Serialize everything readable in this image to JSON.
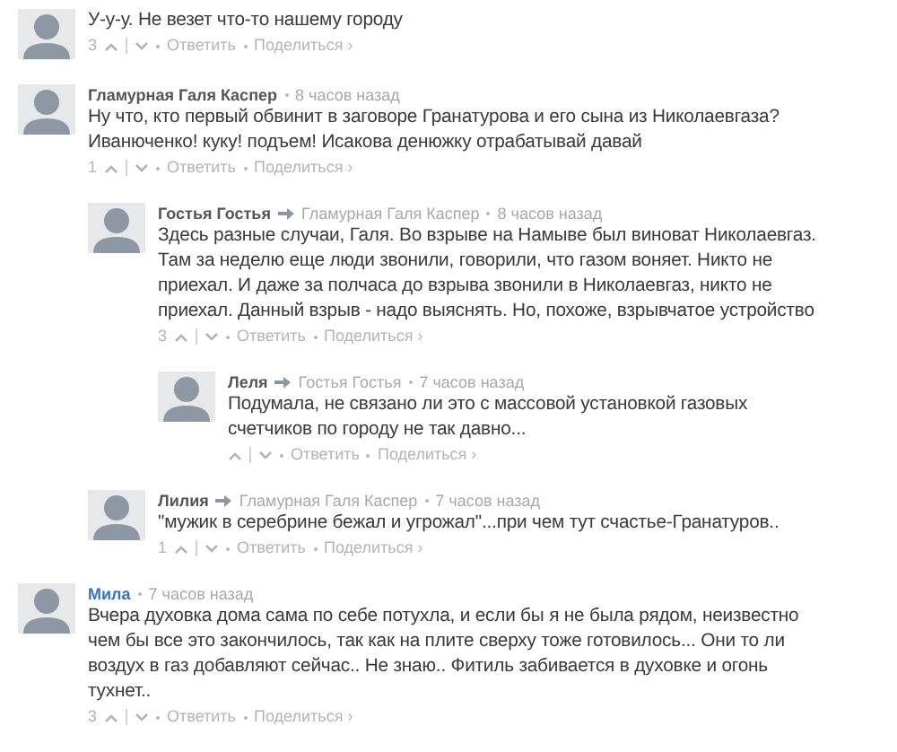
{
  "comments": [
    {
      "text": "У-у-у. Не везет что-то нашему городу",
      "votes": "3",
      "actions": [
        "Ответить",
        "Поделиться ›"
      ]
    },
    {
      "author": "Гламурная Галя Каспер",
      "author_highlighted": false,
      "time": "8 часов назад",
      "text": "Ну что, кто первый обвинит в заговоре Гранатурова и его сына из Николаевгаза? Иванюченко! куку! подъем! Исакова денюжку отрабатывай давай",
      "votes": "1",
      "actions": [
        "Ответить",
        "Поделиться ›"
      ],
      "children": [
        {
          "author": "Гостья Гостья",
          "author_highlighted": false,
          "reply_to": "Гламурная Галя Каспер",
          "time": "8 часов назад",
          "text": "Здесь разные случаи, Галя. Во взрыве на Намыве был виноват Николаевгаз. Там за неделю еще люди звонили, говорили, что газом воняет. Никто не приехал. И даже за полчаса до взрыва звонили в Николаевгаз, никто не приехал. Данный взрыв - надо выяснять. Но, похоже, взрывчатое устройство",
          "votes": "3",
          "actions": [
            "Ответить",
            "Поделиться ›"
          ],
          "children": [
            {
              "author": "Леля",
              "author_highlighted": false,
              "reply_to": "Гостья Гостья",
              "time": "7 часов назад",
              "text": "Подумала, не связано ли это с массовой установкой газовых счетчиков по городу не так давно...",
              "actions": [
                "Ответить",
                "Поделиться ›"
              ]
            }
          ]
        },
        {
          "author": "Лилия",
          "author_highlighted": false,
          "reply_to": "Гламурная Галя Каспер",
          "time": "7 часов назад",
          "text": "\"мужик в серебрине бежал и угрожал\"...при чем тут счастье-Гранатуров..",
          "votes": "1",
          "actions": [
            "Ответить",
            "Поделиться ›"
          ]
        }
      ]
    },
    {
      "author": "Мила",
      "author_highlighted": true,
      "time": "7 часов назад",
      "text": "Вчера духовка дома сама по себе потухла, и если бы я не была рядом, неизвестно чем бы все это закончилось, так как на плите сверху тоже готовилось... Они то ли воздух в газ добавляют сейчас.. Не знаю.. Фитиль забивается в духовке и огонь тухнет..",
      "votes": "3",
      "actions": [
        "Ответить",
        "Поделиться ›"
      ]
    }
  ]
}
